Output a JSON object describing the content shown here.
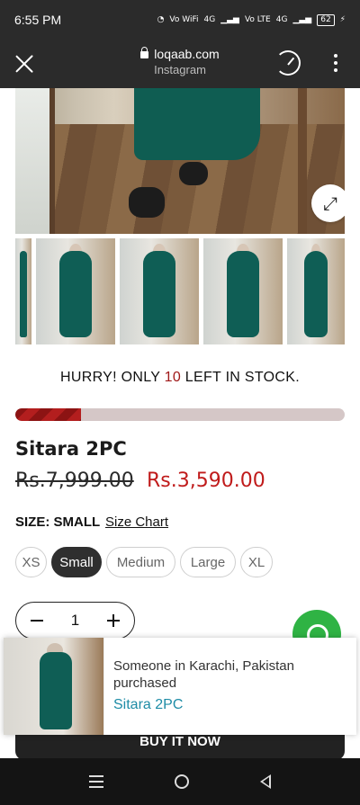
{
  "status_bar": {
    "time": "6:55 PM",
    "indicators": [
      "wifi-icon",
      "Vo WiFi",
      "4G",
      "signal-icon",
      "Vo LTE",
      "4G",
      "signal-icon"
    ],
    "battery": "62"
  },
  "browser": {
    "domain": "loqaab.com",
    "source": "Instagram"
  },
  "product": {
    "stock_prefix": "HURRY! ONLY ",
    "stock_count": "10",
    "stock_suffix": " LEFT IN STOCK.",
    "stock_fraction": 0.2,
    "title": "Sitara 2PC",
    "price_old": "Rs.7,999.00",
    "price_new": "Rs.3,590.00",
    "size_label": "SIZE: SMALL",
    "size_chart": "Size Chart",
    "sizes": [
      "XS",
      "Small",
      "Medium",
      "Large",
      "XL"
    ],
    "selected_size": "Small",
    "quantity": "1",
    "buy_label": "BUY IT NOW"
  },
  "notification": {
    "message": "Someone in Karachi, Pakistan purchased",
    "product": "Sitara 2PC"
  },
  "colors": {
    "accent_red": "#c01b1b",
    "link_teal": "#1e8ca6",
    "whatsapp_green": "#2fb344",
    "dark": "#222222"
  }
}
